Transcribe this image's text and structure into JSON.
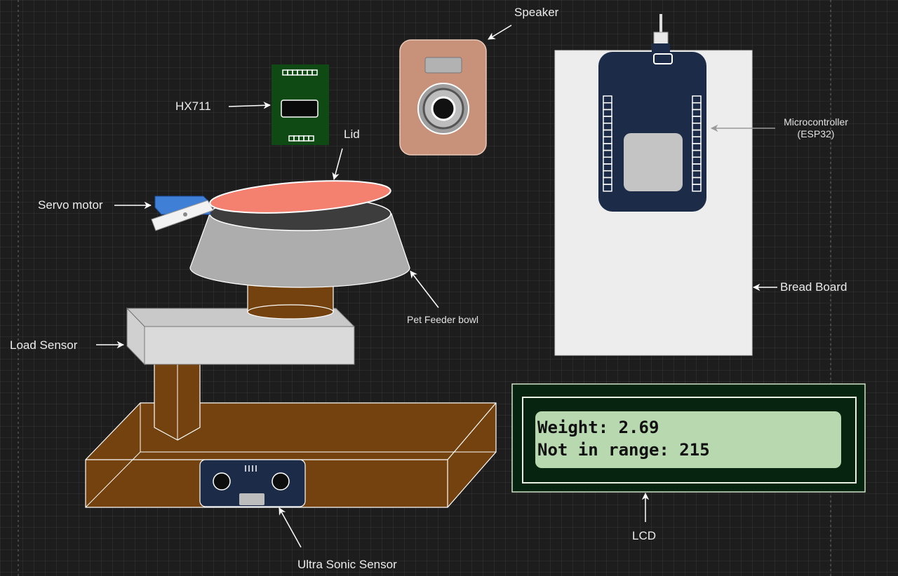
{
  "labels": {
    "speaker": "Speaker",
    "hx711": "HX711",
    "lid": "Lid",
    "servo": "Servo motor",
    "microcontroller_line1": "Microcontroller",
    "microcontroller_line2": "(ESP32)",
    "breadboard": "Bread Board",
    "bowl": "Pet Feeder bowl",
    "load_sensor": "Load Sensor",
    "lcd": "LCD",
    "ultrasonic": "Ultra Sonic Sensor"
  },
  "lcd_display": {
    "line1": "Weight: 2.69",
    "line2": "Not in range: 215"
  },
  "colors": {
    "background": "#1d1d1d",
    "lid": "#f48070",
    "bowl": "#adadad",
    "wood": "#74420e",
    "speaker": "#c8917a",
    "microcontroller": "#1c2b47",
    "breadboard": "#ededed",
    "hx711": "#0f4a15",
    "lcd_frame": "#072410",
    "lcd_screen": "#b8d8b0",
    "servo": "#3f7fd6",
    "ultrasonic": "#1c2b47"
  }
}
